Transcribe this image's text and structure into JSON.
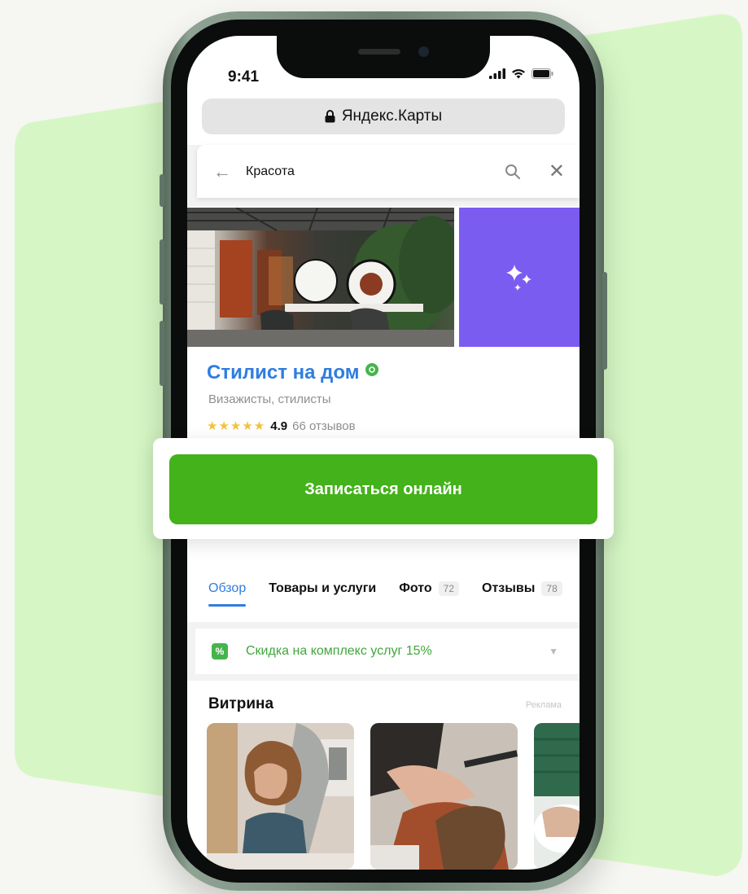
{
  "colors": {
    "page_bg": "#f6f6f2",
    "accent_green_bg": "#d6f7c5",
    "cta_green": "#44b21a",
    "link_blue": "#2f7de1",
    "promo_green": "#3fa73a",
    "purple_tile": "#7b5cf0"
  },
  "status_bar": {
    "time": "9:41",
    "icons": [
      "signal-icon",
      "wifi-icon",
      "battery-icon"
    ]
  },
  "browser": {
    "lock_icon": "lock-icon",
    "title": "Яндекс.Карты"
  },
  "search": {
    "back_icon": "arrow-left-icon",
    "query": "Красота",
    "search_icon": "search-icon",
    "clear_icon": "close-icon"
  },
  "business": {
    "name": "Стилист на дом",
    "verified_icon": "verified-icon",
    "category": "Визажисты, стилисты",
    "rating_stars": 5,
    "rating_value": "4.9",
    "reviews_count": "66 отзывов"
  },
  "cta": {
    "label": "Записаться онлайн"
  },
  "tabs": [
    {
      "label": "Обзор",
      "active": true
    },
    {
      "label": "Товары и услуги"
    },
    {
      "label": "Фото",
      "badge": "72"
    },
    {
      "label": "Отзывы",
      "badge": "78"
    }
  ],
  "promo": {
    "icon": "discount-icon",
    "icon_text": "%",
    "text": "Скидка на комплекс услуг 15%",
    "arrow": "▼"
  },
  "showcase": {
    "title": "Витрина",
    "ad_label": "Реклама"
  }
}
